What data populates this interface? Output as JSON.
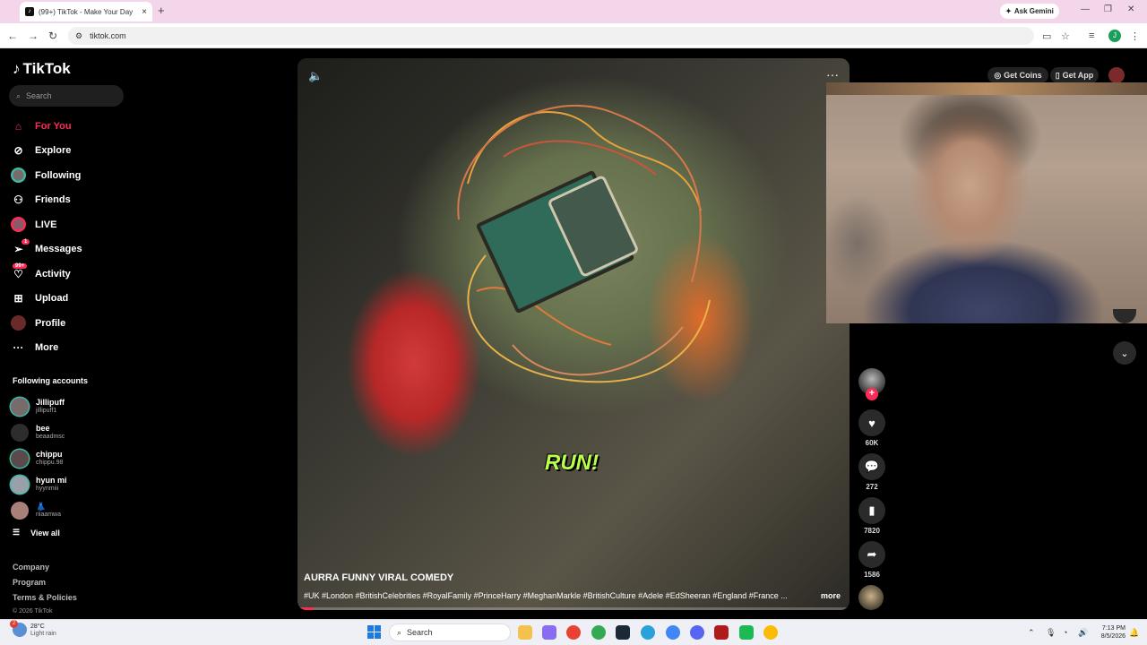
{
  "browser": {
    "tab_title": "(99+) TikTok - Make Your Day",
    "tab_favicon": "tiktok-icon",
    "new_tab": "+",
    "ask_gemini": "Ask Gemini",
    "url": "tiktok.com",
    "profile_initial": "J"
  },
  "sidebar": {
    "logo": "TikTok",
    "search_placeholder": "Search",
    "nav": [
      {
        "label": "For You",
        "icon": "home-icon",
        "active": true
      },
      {
        "label": "Explore",
        "icon": "compass-icon"
      },
      {
        "label": "Following",
        "icon": "following-avatar-icon"
      },
      {
        "label": "Friends",
        "icon": "friends-icon"
      },
      {
        "label": "LIVE",
        "icon": "live-avatar-icon"
      },
      {
        "label": "Messages",
        "icon": "paper-plane-icon",
        "badge": "1"
      },
      {
        "label": "Activity",
        "icon": "activity-icon",
        "badge": "99+"
      },
      {
        "label": "Upload",
        "icon": "upload-icon"
      },
      {
        "label": "Profile",
        "icon": "profile-avatar-icon"
      },
      {
        "label": "More",
        "icon": "more-dots-icon"
      }
    ],
    "following_title": "Following accounts",
    "following": [
      {
        "name": "Jillipuff",
        "handle": "jillipuff1"
      },
      {
        "name": "bee",
        "handle": "beaadmsc"
      },
      {
        "name": "chippu",
        "handle": "chippu.98"
      },
      {
        "name": "hyun mi",
        "handle": "hyynmiii"
      },
      {
        "name": "👗",
        "handle": "riiaamwa"
      }
    ],
    "view_all": "View all",
    "footer": {
      "company": "Company",
      "program": "Program",
      "terms": "Terms & Policies",
      "copyright": "© 2026 TikTok"
    }
  },
  "header": {
    "get_coins": "Get Coins",
    "get_app": "Get App"
  },
  "video": {
    "overlay_text": "RUN!",
    "author": "AURRA FUNNY VIRAL COMEDY",
    "description": "#UK #London #BritishCelebrities #RoyalFamily #PrinceHarry #MeghanMarkle #BritishCulture #Adele #EdSheeran #England #France ...",
    "more": "more",
    "progress_fraction": 0.03
  },
  "actions": {
    "likes": "60K",
    "comments": "272",
    "saves": "7820",
    "shares": "1586"
  },
  "taskbar": {
    "weather_temp": "28°C",
    "weather_desc": "Light rain",
    "weather_badge": "2",
    "search": "Search",
    "time": "7:13 PM",
    "date": "8/5/2026"
  }
}
